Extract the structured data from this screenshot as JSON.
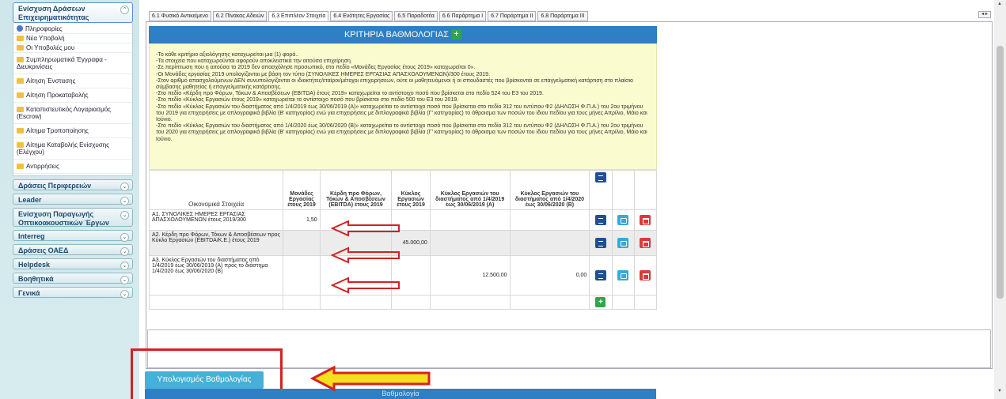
{
  "sidebar": {
    "open_section": "Ενίσχυση Δράσεων Επιχειρηματικότητας",
    "items": [
      {
        "label": "Πληροφορίες",
        "icon": "info-icon"
      },
      {
        "label": "Νέα Υποβολή",
        "icon": "folder-icon"
      },
      {
        "label": "Οι Υποβολές μου",
        "icon": "folder-icon"
      },
      {
        "label": "Συμπληρωματικά Έγγραφα - Διευκρινίσεις",
        "icon": "folder-icon"
      },
      {
        "label": "Αίτηση Ένστασης",
        "icon": "folder-icon"
      },
      {
        "label": "Αίτηση Προκαταβολής",
        "icon": "folder-icon"
      },
      {
        "label": "Καταπιστευτικός Λογαριασμός (Escrow)",
        "icon": "folder-icon"
      },
      {
        "label": "Αίτημα Τροποποίησης",
        "icon": "folder-icon"
      },
      {
        "label": "Αίτημα Καταβολής Ενίσχυσης (Ελέγχου)",
        "icon": "folder-icon"
      },
      {
        "label": "Αντιρρήσεις",
        "icon": "folder-icon"
      }
    ],
    "sections": [
      "Δράσεις Περιφερειών",
      "Leader",
      "Ενίσχυση Παραγωγής Οπτικοακουστικών Έργων",
      "Interreg",
      "Δράσεις ΟΑΕΔ",
      "Helpdesk",
      "Βοηθητικά",
      "Γενικά"
    ]
  },
  "tabs": [
    {
      "label": "6.1 Φυσικό Αντικείμενο",
      "active": false
    },
    {
      "label": "6.2 Πίνακας Αδειών",
      "active": false
    },
    {
      "label": "6.3 Επιπλέον Στοιχεία",
      "active": true
    },
    {
      "label": "6.4 Ενότητες Εργασίας",
      "active": false
    },
    {
      "label": "6.5 Παραδοτέα",
      "active": false
    },
    {
      "label": "6.6 Παράρτημα I",
      "active": false
    },
    {
      "label": "6.7 Παράρτημα II",
      "active": false
    },
    {
      "label": "6.8 Παράρτημα III",
      "active": false
    }
  ],
  "panel": {
    "title": "ΚΡΙΤΗΡΙΑ ΒΑΘΜΟΛΟΓΙΑΣ",
    "notes": [
      "-Το κάθε κριτήριο αξιολόγησης καταχωρείται μια (1) φορά..",
      "-Τα στοιχεία που καταχωρούνται αφορούν αποκλειστικά την αιτούσα επιχείρηση.",
      "-Σε περίπτωση που η αιτούσα το 2019 δεν απασχόλησε προσωπικό, στο πεδίο «Μονάδες Εργασίας έτους 2019» καταχωρείται 0».",
      "-Οι Μονάδες εργασίας 2019 υπολογίζονται με βάση τον τύπο (ΣΥΝΟΛΙΚΕΣ ΗΜΕΡΕΣ ΕΡΓΑΣΙΑΣ ΑΠΑΣΧΟΛΟΥΜΕΝΩΝ)/300 έτους 2019.",
      "-Στον αριθμό απασχολούμενων ΔΕΝ συνυπολογίζονται οι ιδιοκτήτες/εταίροι/μέτοχοι επιχειρήσεων, ούτε οι μαθητευόμενοι ή οι σπουδαστές που βρίσκονται σε επαγγελματική κατάρτιση στο πλαίσιο σύμβασης μαθητείας ή επαγγελματικής κατάρτισης.",
      "-Στο πεδίο «Κέρδη προ Φόρων, Τόκων & Αποσβέσεων (EBITDA) έτους 2019» καταχωρείται το αντίστοιχο ποσό που βρίσκεται στο πεδίο 524 του Ε3 του 2019.",
      "-Στο πεδίο «Κύκλος Εργασιών έτους 2019» καταχωρείται το αντίστοιχο ποσό που βρίσκεται στο πεδίο 500 του Ε3 του 2019.",
      "-Στο πεδίο «Κύκλος Εργασιών του διαστήματος από 1/4/2019 έως 30/06/2019 (Α)» καταχωρείται το αντίστοιχο ποσό που βρίσκεται στο πεδίο 312 του εντύπου Φ2 (ΔΗΛΩΣΗ Φ.Π.Α.) του 2ου τριμήνου του 2019 για επιχειρήσεις με απλογραφικά βιβλία (Β' κατηγορίας) ενώ για επιχειρήσεις με διπλογραφικά βιβλία (Γ' κατηγορίας) το άθροισμα των ποσών του ίδιου πεδίου για τους μήνες Απρίλιο, Μάιο και Ιούνιο.",
      "-Στο πεδίο «Κύκλος Εργασιών του διαστήματος από 1/4/2020 έως 30/06/2020 (Β)» καταχωρείται το αντίστοιχο ποσό που βρίσκεται στο πεδίο 312 του εντύπου Φ2 (ΔΗΛΩΣΗ Φ.Π.Α.) του 2ου τριμήνου του 2020 για επιχειρήσεις με απλογραφικά βιβλία (Β' κατηγορίας) ενώ για επιχειρήσεις με διπλογραφικά βιβλία (Γ' κατηγορίας) το άθροισμα των ποσών του ίδιου πεδίου για τους μήνες Απρίλιο, Μάιο και Ιούνιο."
    ]
  },
  "table": {
    "headers": [
      "Οικονομικά Στοιχεία",
      "Μονάδες Εργασίας έτους 2019",
      "Κέρδη προ Φόρων, Τόκων & Αποσβέσεων (EBITDA) έτους 2019",
      "Κύκλος Εργασιών έτους 2019",
      "Κύκλος Εργασιών του διαστήματος από 1/4/2019 έως 30/06/2019 (Α)",
      "Κύκλος Εργασιών του διαστήματος από 1/4/2020 έως 30/06/2020 (Β)"
    ],
    "rows": [
      {
        "label": "Α1. ΣΥΝΟΛΙΚΕΣ ΗΜΕΡΕΣ ΕΡΓΑΣΙΑΣ ΑΠΑΣΧΟΛΟΥΜΕΝΩΝ έτους 2019/300",
        "values": [
          "1,50",
          "",
          "",
          "",
          ""
        ]
      },
      {
        "label": "Α2. Κέρδη προ Φόρων, Τόκων & Αποσβέσεων προς Κύκλο Εργασιών (EBITDA/K.E.) έτους 2019",
        "values": [
          "",
          "",
          "45.000,00",
          "",
          ""
        ]
      },
      {
        "label": "Α3. Κύκλος Εργασιών του διαστήματος από 1/4/2019 έως 30/06/2019 (Α) προς το διάστημα 1/4/2020 έως 30/06/2020 (Β)",
        "values": [
          "",
          "",
          "",
          "12.500,00",
          "0,00"
        ]
      }
    ]
  },
  "buttons": {
    "calculate": "Υπολογισμός Βαθμολογίας",
    "score_bar": "Βαθμολογία",
    "pager": "◂ ▸"
  },
  "colors": {
    "panel_header": "#2e7fc3",
    "notes_background": "#fbfbd0",
    "annotation_red": "#d62020",
    "annotation_yellow": "#f5e020"
  }
}
